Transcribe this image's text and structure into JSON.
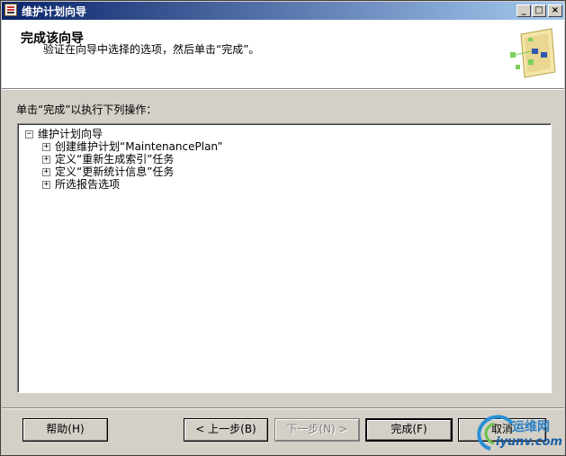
{
  "window": {
    "title": "维护计划向导"
  },
  "titlebar_buttons": {
    "minimize": "_",
    "maximize": "□",
    "close": "×"
  },
  "header": {
    "title": "完成该向导",
    "subtitle": "验证在向导中选择的选项，然后单击“完成”。"
  },
  "instruction": "单击“完成”以执行下列操作：",
  "tree": {
    "root": {
      "toggle": "−",
      "label": "维护计划向导"
    },
    "children": [
      {
        "toggle": "+",
        "label": "创建维护计划“MaintenancePlan”"
      },
      {
        "toggle": "+",
        "label": "定义“重新生成索引”任务"
      },
      {
        "toggle": "+",
        "label": "定义“更新统计信息”任务"
      },
      {
        "toggle": "+",
        "label": "所选报告选项"
      }
    ]
  },
  "buttons": {
    "help": "帮助(H)",
    "back": "< 上一步(B)",
    "next": "下一步(N) >",
    "finish": "完成(F)",
    "cancel": "取消"
  },
  "watermark": {
    "text": "运维网",
    "url": "iyunv.com"
  },
  "colors": {
    "titlebar_start": "#0a246a",
    "titlebar_end": "#a6caf0",
    "face": "#d4d0c8"
  }
}
